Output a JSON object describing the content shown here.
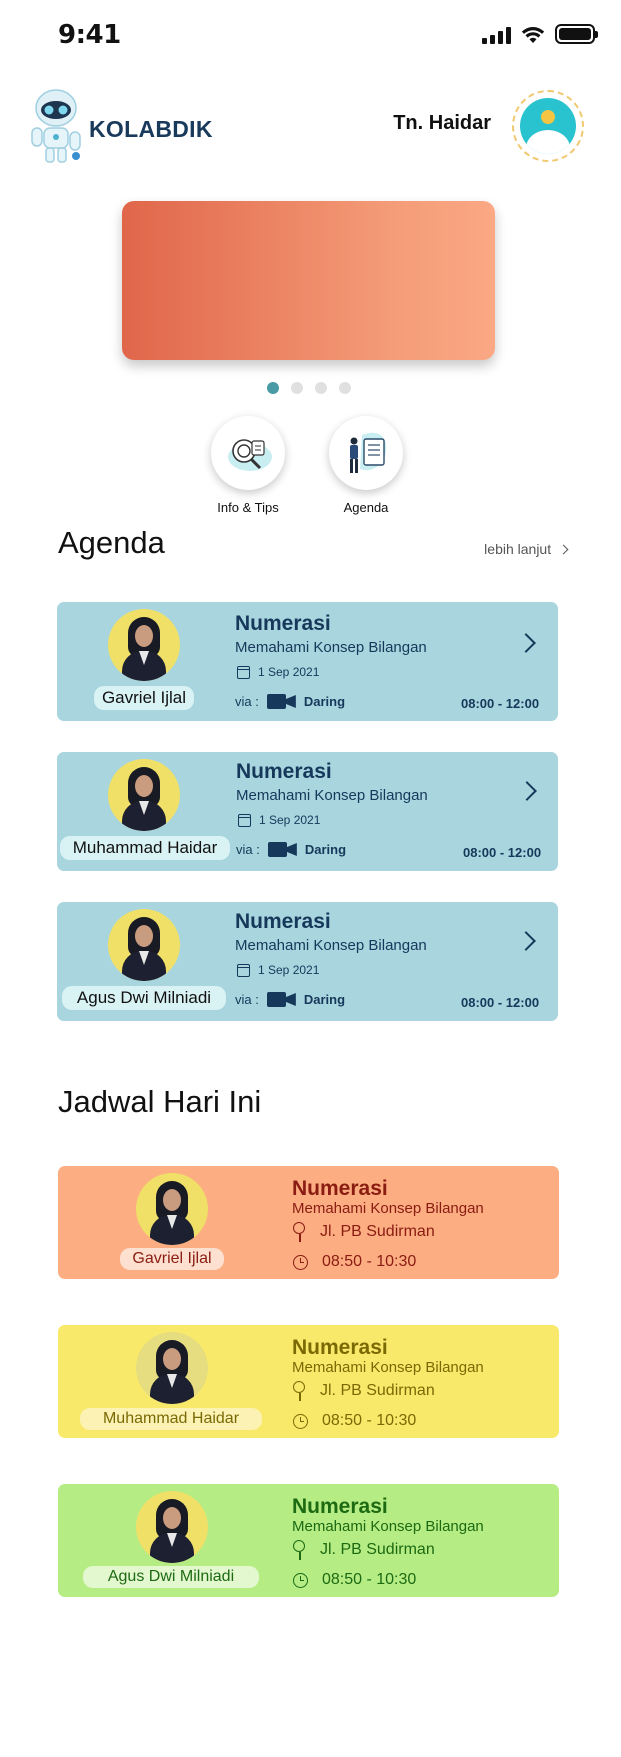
{
  "status_bar": {
    "time": "9:41",
    "signal_icon": "cellular-signal-icon",
    "wifi_icon": "wifi-icon",
    "battery_icon": "battery-icon"
  },
  "header": {
    "app_name": "KOLABDIK",
    "user_name": "Tn. Haidar",
    "logo_icon": "robot-logo-icon",
    "avatar_icon": "user-avatar-icon"
  },
  "banner": {
    "active_slide": 1,
    "slide_count": 4
  },
  "quick_menu": [
    {
      "label": "Info & Tips",
      "icon": "info-tips-icon"
    },
    {
      "label": "Agenda",
      "icon": "agenda-icon"
    }
  ],
  "agenda": {
    "title": "Agenda",
    "more_label": "lebih lanjut",
    "via_label": "via :",
    "items": [
      {
        "name": "Gavriel Ijlal",
        "subject": "Numerasi",
        "topic": "Memahami Konsep Bilangan",
        "date": "1 Sep 2021",
        "mode": "Daring",
        "time": "08:00 - 12:00"
      },
      {
        "name": "Muhammad Haidar",
        "subject": "Numerasi",
        "topic": "Memahami Konsep Bilangan",
        "date": "1 Sep 2021",
        "mode": "Daring",
        "time": "08:00 - 12:00"
      },
      {
        "name": "Agus Dwi Milniadi",
        "subject": "Numerasi",
        "topic": "Memahami Konsep Bilangan",
        "date": "1 Sep 2021",
        "mode": "Daring",
        "time": "08:00 - 12:00"
      }
    ]
  },
  "schedule": {
    "title": "Jadwal Hari Ini",
    "items": [
      {
        "name": "Gavriel Ijlal",
        "subject": "Numerasi",
        "topic": "Memahami Konsep Bilangan",
        "location": "Jl. PB Sudirman",
        "time": "08:50 - 10:30",
        "bg": "#fcad82",
        "text": "#8a1c12",
        "pill": "#fde0cf",
        "photo_bg": "#f0e068"
      },
      {
        "name": "Muhammad Haidar",
        "subject": "Numerasi",
        "topic": "Memahami Konsep Bilangan",
        "location": "Jl. PB Sudirman",
        "time": "08:50 - 10:30",
        "bg": "#f9e96a",
        "text": "#7a6a05",
        "pill": "#fbf2b4",
        "photo_bg": "#e6dd80"
      },
      {
        "name": "Agus Dwi Milniadi",
        "subject": "Numerasi",
        "topic": "Memahami Konsep Bilangan",
        "location": "Jl. PB Sudirman",
        "time": "08:50 - 10:30",
        "bg": "#b6ec84",
        "text": "#1c6a12",
        "pill": "#e4f8cf",
        "photo_bg": "#f0e068"
      }
    ]
  }
}
